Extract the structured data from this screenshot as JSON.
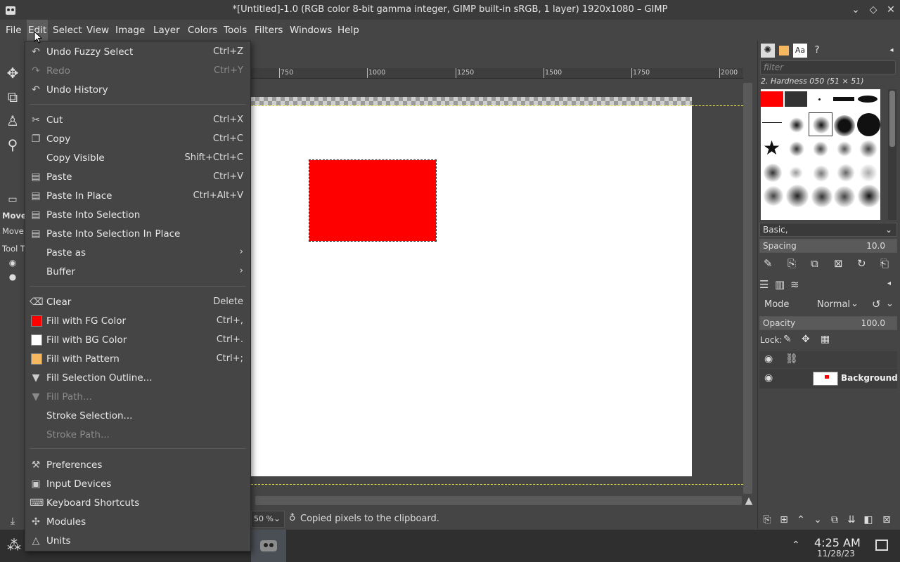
{
  "window": {
    "title": "*[Untitled]-1.0 (RGB color 8-bit gamma integer, GIMP built-in sRGB, 1 layer) 1920x1080 – GIMP",
    "controls": [
      "chevron-down-icon",
      "diamond-icon",
      "close-icon"
    ]
  },
  "menubar": {
    "items": [
      "File",
      "Edit",
      "Select",
      "View",
      "Image",
      "Layer",
      "Colors",
      "Tools",
      "Filters",
      "Windows",
      "Help"
    ],
    "active": "Edit"
  },
  "edit_menu": {
    "items": [
      {
        "label": "Undo Fuzzy Select",
        "shortcut": "Ctrl+Z",
        "icon": "undo-icon",
        "disabled": false
      },
      {
        "label": "Redo",
        "shortcut": "Ctrl+Y",
        "icon": "redo-icon",
        "disabled": true
      },
      {
        "label": "Undo History",
        "shortcut": "",
        "icon": "undo-history-icon",
        "disabled": false
      },
      {
        "label": "Cut",
        "shortcut": "Ctrl+X",
        "icon": "scissors-icon",
        "disabled": false
      },
      {
        "label": "Copy",
        "shortcut": "Ctrl+C",
        "icon": "copy-icon",
        "disabled": false
      },
      {
        "label": "Copy Visible",
        "shortcut": "Shift+Ctrl+C",
        "icon": "",
        "disabled": false
      },
      {
        "label": "Paste",
        "shortcut": "Ctrl+V",
        "icon": "paste-icon",
        "disabled": false
      },
      {
        "label": "Paste In Place",
        "shortcut": "Ctrl+Alt+V",
        "icon": "paste-icon",
        "disabled": false
      },
      {
        "label": "Paste Into Selection",
        "shortcut": "",
        "icon": "paste-icon",
        "disabled": false
      },
      {
        "label": "Paste Into Selection In Place",
        "shortcut": "",
        "icon": "paste-icon",
        "disabled": false
      },
      {
        "label": "Paste as",
        "shortcut": "",
        "icon": "",
        "disabled": false,
        "submenu": true
      },
      {
        "label": "Buffer",
        "shortcut": "",
        "icon": "",
        "disabled": false,
        "submenu": true
      },
      {
        "label": "Clear",
        "shortcut": "Delete",
        "icon": "clear-icon",
        "disabled": false
      },
      {
        "label": "Fill with FG Color",
        "shortcut": "Ctrl+,",
        "icon": "fg-color-swatch",
        "swatch": "#ff0000",
        "disabled": false
      },
      {
        "label": "Fill with BG Color",
        "shortcut": "Ctrl+.",
        "icon": "bg-color-swatch",
        "swatch": "#ffffff",
        "disabled": false
      },
      {
        "label": "Fill with Pattern",
        "shortcut": "Ctrl+;",
        "icon": "pattern-swatch",
        "swatch": "#f6b85e",
        "disabled": false
      },
      {
        "label": "Fill Selection Outline...",
        "shortcut": "",
        "icon": "fill-icon",
        "disabled": false
      },
      {
        "label": "Fill Path...",
        "shortcut": "",
        "icon": "fill-icon",
        "disabled": true
      },
      {
        "label": "Stroke Selection...",
        "shortcut": "",
        "icon": "",
        "disabled": false
      },
      {
        "label": "Stroke Path...",
        "shortcut": "",
        "icon": "",
        "disabled": true
      },
      {
        "label": "Preferences",
        "shortcut": "",
        "icon": "preferences-icon",
        "disabled": false
      },
      {
        "label": "Input Devices",
        "shortcut": "",
        "icon": "input-devices-icon",
        "disabled": false
      },
      {
        "label": "Keyboard Shortcuts",
        "shortcut": "",
        "icon": "keyboard-icon",
        "disabled": false
      },
      {
        "label": "Modules",
        "shortcut": "",
        "icon": "modules-icon",
        "disabled": false
      },
      {
        "label": "Units",
        "shortcut": "",
        "icon": "units-icon",
        "disabled": false
      }
    ]
  },
  "toolbox": {
    "tool_options_title": "Move",
    "tool_options_sub": "Move:",
    "tool_toggle": "Tool T"
  },
  "ruler": {
    "labels": [
      "750",
      "1000",
      "1250",
      "1500",
      "1750",
      "2000"
    ]
  },
  "statusbar": {
    "zoom": "50 %",
    "message": "Copied pixels to the clipboard."
  },
  "dock": {
    "filter_placeholder": "filter",
    "brush_name": "2. Hardness 050 (51 × 51)",
    "brush_set": "Basic,",
    "spacing_label": "Spacing",
    "spacing_value": "10.0",
    "mode_label": "Mode",
    "mode_value": "Normal",
    "opacity_label": "Opacity",
    "opacity_value": "100.0",
    "lock_label": "Lock:",
    "layer_name": "Background"
  },
  "taskbar": {
    "time": "4:25 AM",
    "date": "11/28/23"
  },
  "colors": {
    "fg": "#ff0000",
    "bg": "#ffffff",
    "selection": "#e8e24a"
  }
}
